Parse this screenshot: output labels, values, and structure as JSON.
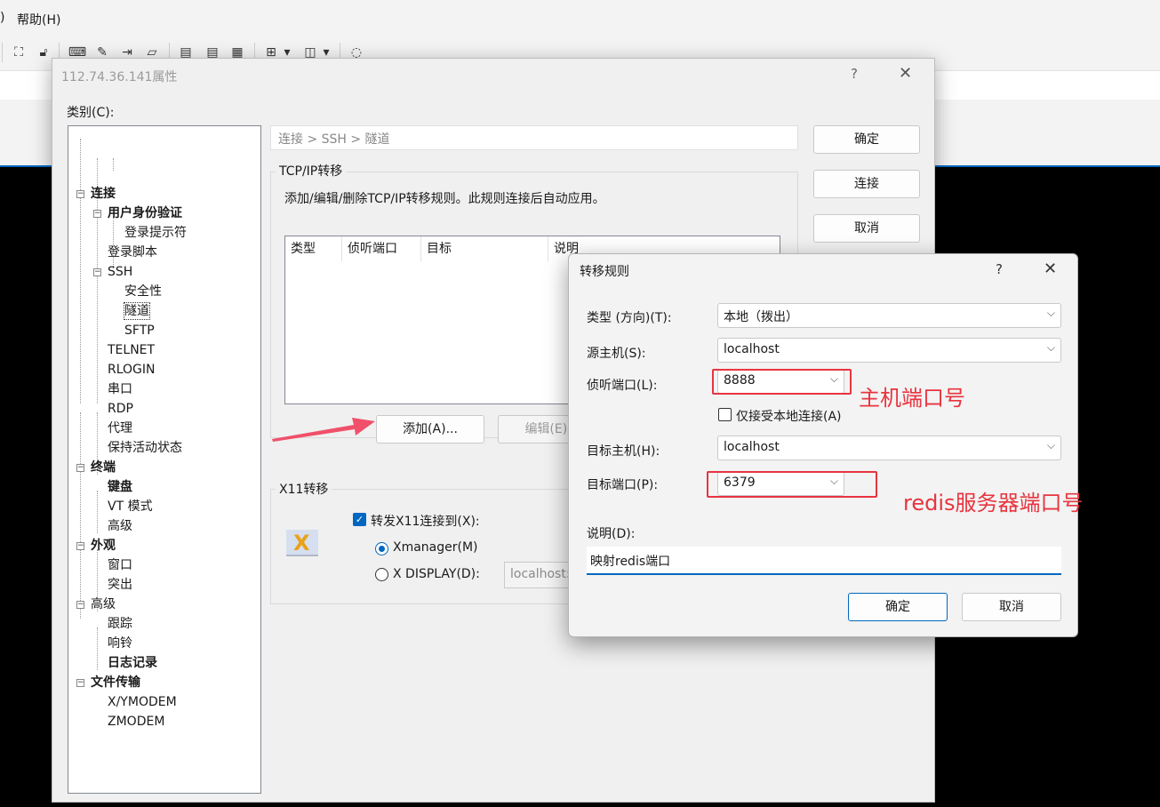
{
  "menu": {
    "paren": ")",
    "help": "帮助(H)"
  },
  "toolbar": {
    "dropdown": "▾"
  },
  "props_dialog": {
    "title": "112.74.36.141属性",
    "help": "?",
    "close": "✕",
    "category_label": "类别(C):",
    "breadcrumb": "连接 > SSH > 隧道",
    "tree": [
      {
        "label": "连接",
        "bold": true
      },
      {
        "label": "用户身份验证",
        "bold": true
      },
      {
        "label": "登录提示符"
      },
      {
        "label": "登录脚本"
      },
      {
        "label": "SSH"
      },
      {
        "label": "安全性"
      },
      {
        "label": "隧道",
        "selected": true
      },
      {
        "label": "SFTP"
      },
      {
        "label": "TELNET"
      },
      {
        "label": "RLOGIN"
      },
      {
        "label": "串口"
      },
      {
        "label": "RDP"
      },
      {
        "label": "代理"
      },
      {
        "label": "保持活动状态"
      },
      {
        "label": "终端",
        "bold": true
      },
      {
        "label": "键盘",
        "bold": true
      },
      {
        "label": "VT 模式"
      },
      {
        "label": "高级"
      },
      {
        "label": "外观",
        "bold": true
      },
      {
        "label": "窗口"
      },
      {
        "label": "突出"
      },
      {
        "label": "高级"
      },
      {
        "label": "跟踪"
      },
      {
        "label": "响铃"
      },
      {
        "label": "日志记录",
        "bold": true
      },
      {
        "label": "文件传输",
        "bold": true
      },
      {
        "label": "X/YMODEM"
      },
      {
        "label": "ZMODEM"
      }
    ],
    "tcpip": {
      "group_label": "TCP/IP转移",
      "description": "添加/编辑/删除TCP/IP转移规则。此规则连接后自动应用。",
      "columns": [
        "类型",
        "侦听端口",
        "目标",
        "说明"
      ],
      "add_button": "添加(A)...",
      "edit_button": "编辑(E)..."
    },
    "x11": {
      "group_label": "X11转移",
      "logo_letter": "X",
      "forward_label": "转发X11连接到(X):",
      "forward_checked": true,
      "xmanager_label": "Xmanager(M)",
      "xdisplay_label": "X DISPLAY(D):",
      "xdisplay_value": "localhost:"
    },
    "buttons": {
      "ok": "确定",
      "connect": "连接",
      "cancel": "取消"
    }
  },
  "rule_dialog": {
    "title": "转移规则",
    "help": "?",
    "close": "✕",
    "type_label": "类型 (方向)(T):",
    "type_value": "本地（拨出）",
    "source_host_label": "源主机(S):",
    "source_host_value": "localhost",
    "listen_port_label": "侦听端口(L):",
    "listen_port_value": "8888",
    "local_only_label": "仅接受本地连接(A)",
    "local_only_checked": false,
    "target_host_label": "目标主机(H):",
    "target_host_value": "localhost",
    "target_port_label": "目标端口(P):",
    "target_port_value": "6379",
    "description_label": "说明(D):",
    "description_value": "映射redis端口",
    "ok": "确定",
    "cancel": "取消"
  },
  "annotations": {
    "host_port": "主机端口号",
    "redis_port": "redis服务器端口号",
    "color": "#e8343f"
  }
}
